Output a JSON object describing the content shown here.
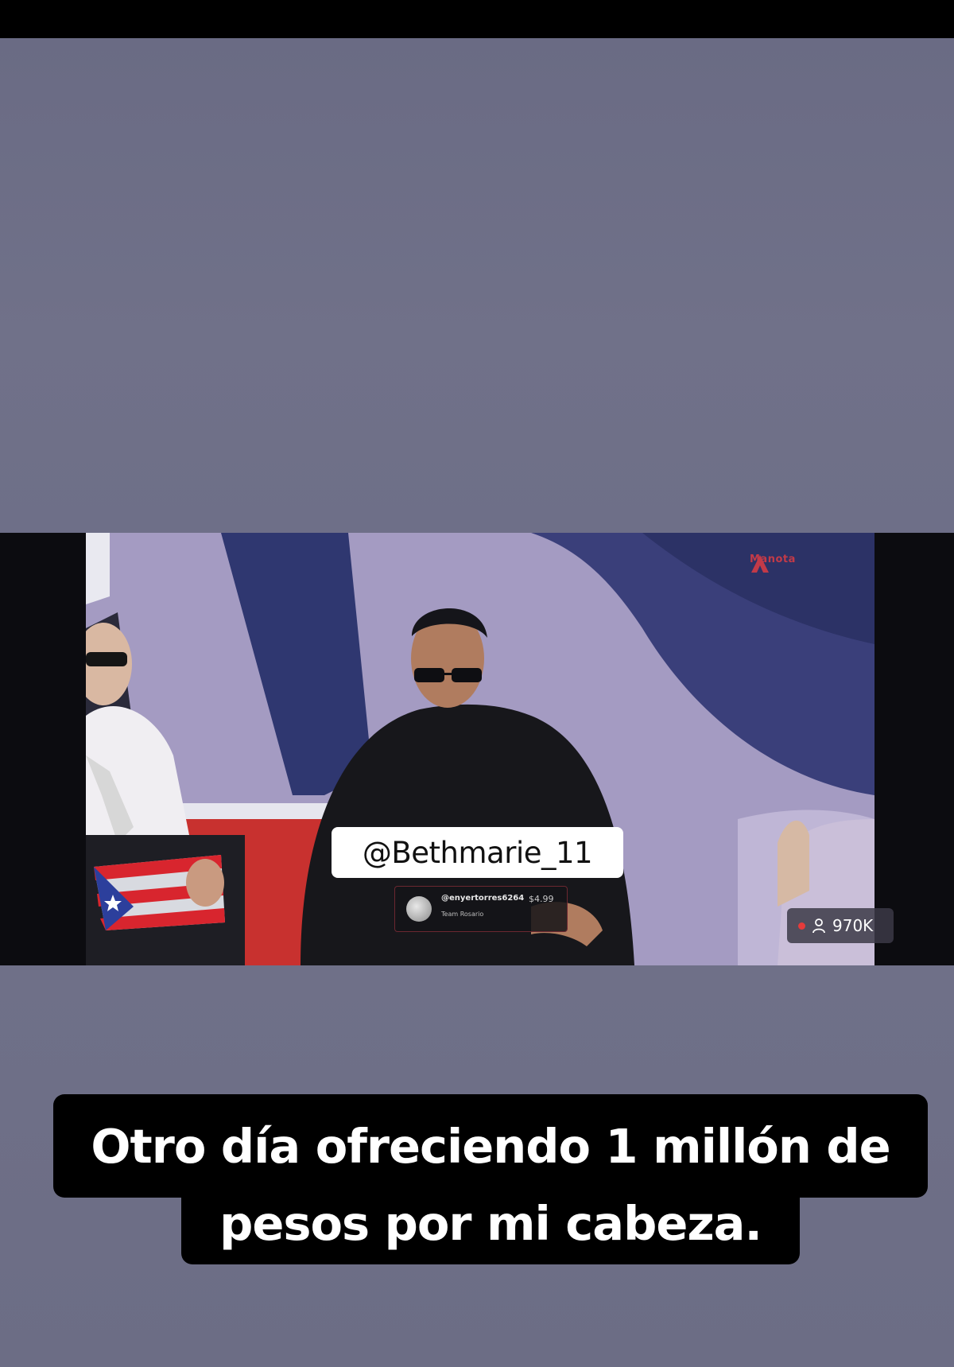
{
  "video": {
    "brand_text": "Manota",
    "overlay_handle": "@Bethmarie_11",
    "donation": {
      "username": "@enyertorres6264",
      "amount": "$4.99",
      "message": "Team Rosario"
    },
    "viewers": {
      "count": "970K",
      "icon": "person-icon",
      "live_color": "#e53b3b"
    }
  },
  "caption": {
    "line1": "Otro día ofreciendo 1 millón de",
    "line2": "pesos por mi cabeza."
  },
  "colors": {
    "background": "#6e7088",
    "caption_bg": "#000000",
    "caption_text": "#ffffff"
  }
}
